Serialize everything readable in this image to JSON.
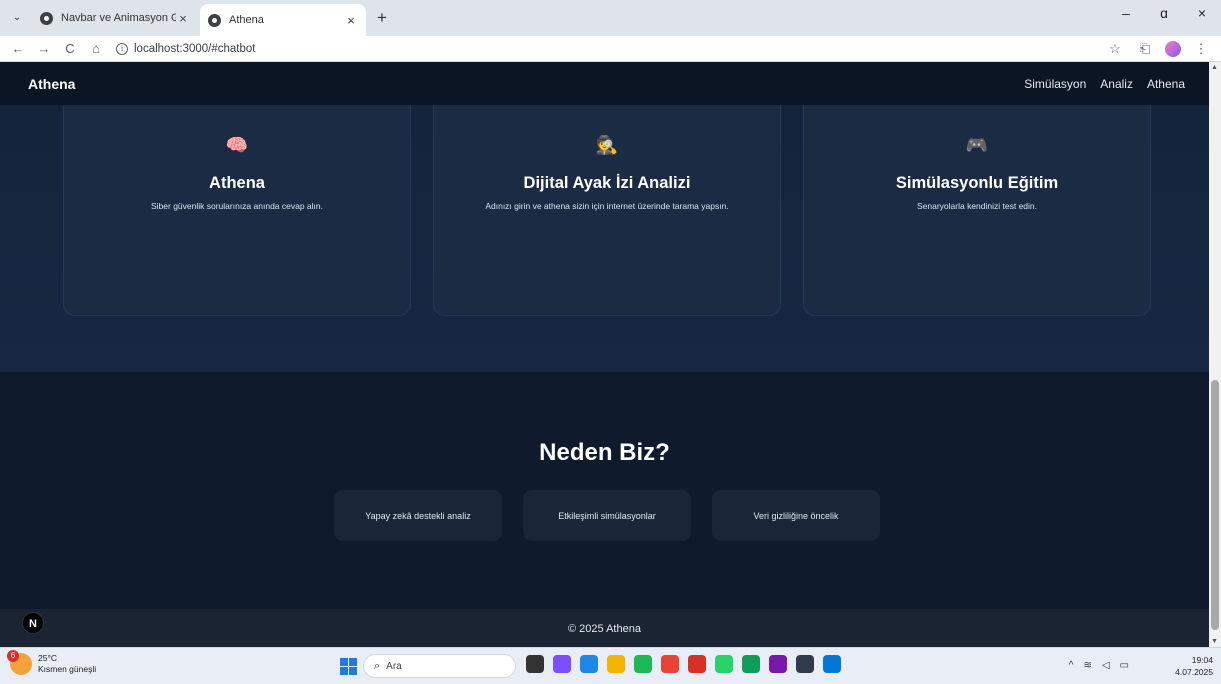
{
  "browser": {
    "tabs": [
      {
        "title": "Navbar ve Animasyon Geliştirm",
        "close": "×"
      },
      {
        "title": "Athena",
        "close": "×"
      }
    ],
    "new_tab": "+",
    "window_controls": {
      "minimize": "–",
      "maximize": "ɑ",
      "close": "×"
    },
    "nav": {
      "back": "←",
      "forward": "→",
      "reload": "C",
      "home": "⌂"
    },
    "url": "localhost:3000/#chatbot",
    "toolbar_icons": {
      "bookmark": "☆",
      "extensions": "⎗",
      "menu": "⋮"
    }
  },
  "page": {
    "navbar": {
      "brand": "Athena",
      "links": [
        "Simülasyon",
        "Analiz",
        "Athena"
      ]
    },
    "features": [
      {
        "emoji": "🧠",
        "title": "Athena",
        "desc": "Siber güvenlik sorularınıza anında cevap alın."
      },
      {
        "emoji": "🕵️",
        "title": "Dijital Ayak İzi Analizi",
        "desc": "Adınızı girin ve athena sizin için internet üzerinde tarama yapsın."
      },
      {
        "emoji": "🎮",
        "title": "Simülasyonlu Eğitim",
        "desc": "Senaryolarla kendinizi test edin."
      }
    ],
    "why": {
      "title": "Neden Biz?",
      "items": [
        "Yapay zekâ destekli analiz",
        "Etkileşimli simülasyonlar",
        "Veri gizliliğine öncelik"
      ]
    },
    "footer": {
      "copyright": "© 2025 Athena"
    },
    "next_badge": "N"
  },
  "taskbar": {
    "weather": {
      "temp": "25°C",
      "desc": "Kısmen güneşli",
      "badge": "6"
    },
    "search_placeholder": "Ara",
    "time": "19:04",
    "date": "4.07.2025",
    "app_colors": [
      "#333333",
      "#7c4dff",
      "#1e88e5",
      "#f4b400",
      "#1db954",
      "#ea4335",
      "#d93025",
      "#25d366",
      "#0f9d58",
      "#7719aa",
      "#2f3a4a",
      "#0078d4"
    ]
  }
}
